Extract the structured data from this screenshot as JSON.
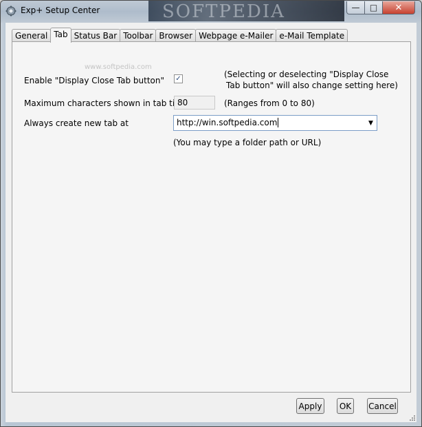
{
  "window": {
    "title": "Exp+ Setup Center",
    "watermark": "SOFTPEDIA",
    "panel_watermark": "www.softpedia.com",
    "buttons": {
      "minimize": "—",
      "maximize": "□",
      "close": "✕"
    }
  },
  "tabs": [
    {
      "label": "General"
    },
    {
      "label": "Tab",
      "active": true
    },
    {
      "label": "Status Bar"
    },
    {
      "label": "Toolbar"
    },
    {
      "label": "Browser"
    },
    {
      "label": "Webpage e-Mailer"
    },
    {
      "label": "e-Mail Template"
    }
  ],
  "settings": {
    "close_button_label": "Enable \"Display Close Tab button\"",
    "close_button_checked": true,
    "close_button_note_line1": "(Selecting or deselecting \"Display Close",
    "close_button_note_line2": "Tab button\" will also change setting here)",
    "max_chars_label": "Maximum characters shown in tab title",
    "max_chars_value": "80",
    "max_chars_note": "(Ranges from 0 to 80)",
    "new_tab_label": "Always create new tab at",
    "new_tab_value": "http://win.softpedia.com",
    "new_tab_note": "(You may type a folder path or URL)"
  },
  "footer": {
    "apply": "Apply",
    "ok": "OK",
    "cancel": "Cancel"
  }
}
